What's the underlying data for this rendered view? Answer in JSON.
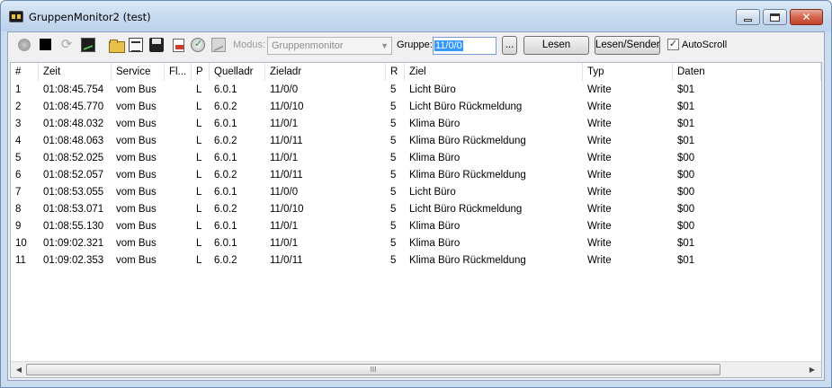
{
  "window": {
    "title": "GruppenMonitor2 (test)",
    "close_label": "✕"
  },
  "toolbar": {
    "icons": [
      "record-icon",
      "stop-icon",
      "refresh-icon",
      "monitor-icon",
      "open-folder-icon",
      "list-icon",
      "save-icon",
      "export-icon",
      "filter-icon",
      "chart-icon"
    ],
    "modus_label": "Modus:",
    "modus_value": "Gruppenmonitor",
    "gruppe_label": "Gruppe:",
    "gruppe_value": "11/0/0",
    "browse_label": "...",
    "lesen_label": "Lesen",
    "lesen_sender_label": "Lesen/Sender",
    "autoscroll_label": "AutoScroll",
    "autoscroll_checked": true
  },
  "grid": {
    "columns": [
      "#",
      "Zeit",
      "Service",
      "Fl...",
      "P",
      "Quelladr",
      "Zieladr",
      "R",
      "Ziel",
      "Typ",
      "Daten"
    ],
    "rows": [
      [
        "1",
        "01:08:45.754",
        "vom Bus",
        "",
        "L",
        "6.0.1",
        "11/0/0",
        "5",
        "Licht Büro",
        "Write",
        "$01"
      ],
      [
        "2",
        "01:08:45.770",
        "vom Bus",
        "",
        "L",
        "6.0.2",
        "11/0/10",
        "5",
        "Licht Büro Rückmeldung",
        "Write",
        "$01"
      ],
      [
        "3",
        "01:08:48.032",
        "vom Bus",
        "",
        "L",
        "6.0.1",
        "11/0/1",
        "5",
        "Klima Büro",
        "Write",
        "$01"
      ],
      [
        "4",
        "01:08:48.063",
        "vom Bus",
        "",
        "L",
        "6.0.2",
        "11/0/11",
        "5",
        "Klima Büro Rückmeldung",
        "Write",
        "$01"
      ],
      [
        "5",
        "01:08:52.025",
        "vom Bus",
        "",
        "L",
        "6.0.1",
        "11/0/1",
        "5",
        "Klima Büro",
        "Write",
        "$00"
      ],
      [
        "6",
        "01:08:52.057",
        "vom Bus",
        "",
        "L",
        "6.0.2",
        "11/0/11",
        "5",
        "Klima Büro Rückmeldung",
        "Write",
        "$00"
      ],
      [
        "7",
        "01:08:53.055",
        "vom Bus",
        "",
        "L",
        "6.0.1",
        "11/0/0",
        "5",
        "Licht Büro",
        "Write",
        "$00"
      ],
      [
        "8",
        "01:08:53.071",
        "vom Bus",
        "",
        "L",
        "6.0.2",
        "11/0/10",
        "5",
        "Licht Büro Rückmeldung",
        "Write",
        "$00"
      ],
      [
        "9",
        "01:08:55.130",
        "vom Bus",
        "",
        "L",
        "6.0.1",
        "11/0/1",
        "5",
        "Klima Büro",
        "Write",
        "$00"
      ],
      [
        "10",
        "01:09:02.321",
        "vom Bus",
        "",
        "L",
        "6.0.1",
        "11/0/1",
        "5",
        "Klima Büro",
        "Write",
        "$01"
      ],
      [
        "11",
        "01:09:02.353",
        "vom Bus",
        "",
        "L",
        "6.0.2",
        "11/0/11",
        "5",
        "Klima Büro Rückmeldung",
        "Write",
        "$01"
      ]
    ]
  },
  "scrollbar": {
    "left_arrow": "◀",
    "right_arrow": "▶",
    "thumb_grip": "III"
  }
}
